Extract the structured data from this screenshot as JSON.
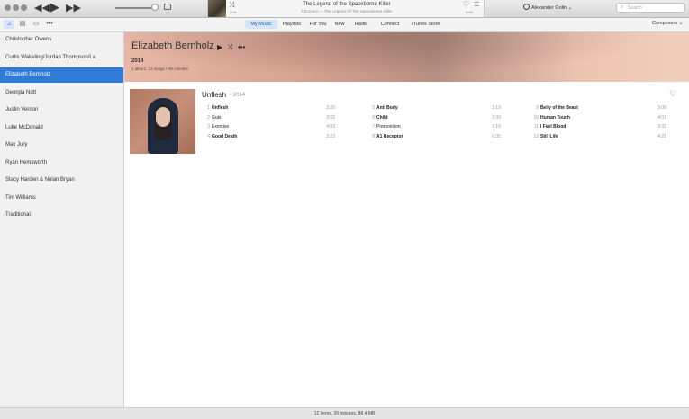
{
  "lcd": {
    "shuffle_icon": "shuffle-icon",
    "time_elapsed": "2:01",
    "title": "The Legend of the Spaceborne Killer",
    "subtitle": "Chrononi — The Legend Of The Spaceborne Killer",
    "time_remaining": "4:03"
  },
  "account": {
    "name": "Alexander Golin ⌄"
  },
  "search": {
    "placeholder": "Search"
  },
  "nav": {
    "tabs": [
      "My Music",
      "Playlists",
      "For You",
      "New",
      "Radio",
      "Connect",
      "iTunes Store"
    ],
    "active_tab": "My Music",
    "composers": "Composers ⌄"
  },
  "sidebar": {
    "items": [
      "Christopher Owens",
      "Curtis Wakeling/Jordan Thompson/La...",
      "Elizabeth Bernholz",
      "Georgia Nott",
      "Justin Vernon",
      "Luke McDonald",
      "Max Jury",
      "Ryan Hemsworth",
      "Stacy Harden & Nolan Bryan",
      "Tim Williams",
      "Traditional"
    ],
    "selected": "Elizabeth Bernholz"
  },
  "artist": {
    "name": "Elizabeth Bernholz",
    "year": "2014",
    "summary": "1 album, 12 songs • 39 minutes"
  },
  "album": {
    "title": "Unflesh",
    "year": "• 2014",
    "tracks": [
      {
        "num": "1",
        "name": "Unflesh",
        "dur": "3:20",
        "bold": true
      },
      {
        "num": "2",
        "name": "Guts",
        "dur": "3:02",
        "bold": false
      },
      {
        "num": "3",
        "name": "Exercise",
        "dur": "4:03",
        "bold": false
      },
      {
        "num": "4",
        "name": "Good Death",
        "dur": "3:23",
        "bold": true
      },
      {
        "num": "5",
        "name": "Anti Body",
        "dur": "3:19",
        "bold": true
      },
      {
        "num": "6",
        "name": "Child",
        "dur": "2:30",
        "bold": true
      },
      {
        "num": "7",
        "name": "Premonition",
        "dur": "3:19",
        "bold": false
      },
      {
        "num": "8",
        "name": "A1 Receptor",
        "dur": "0:35",
        "bold": true
      },
      {
        "num": "9",
        "name": "Belly of the Beast",
        "dur": "3:00",
        "bold": true
      },
      {
        "num": "10",
        "name": "Human Touch",
        "dur": "4:01",
        "bold": true
      },
      {
        "num": "11",
        "name": "I Feel Blood",
        "dur": "3:32",
        "bold": true
      },
      {
        "num": "12",
        "name": "Still Life",
        "dur": "4:21",
        "bold": true
      }
    ]
  },
  "status": {
    "text": "12 items, 39 minutes, 88.4 MB"
  },
  "colors": {
    "accent": "#2f7bd6",
    "header_tint": "#d8a392"
  }
}
